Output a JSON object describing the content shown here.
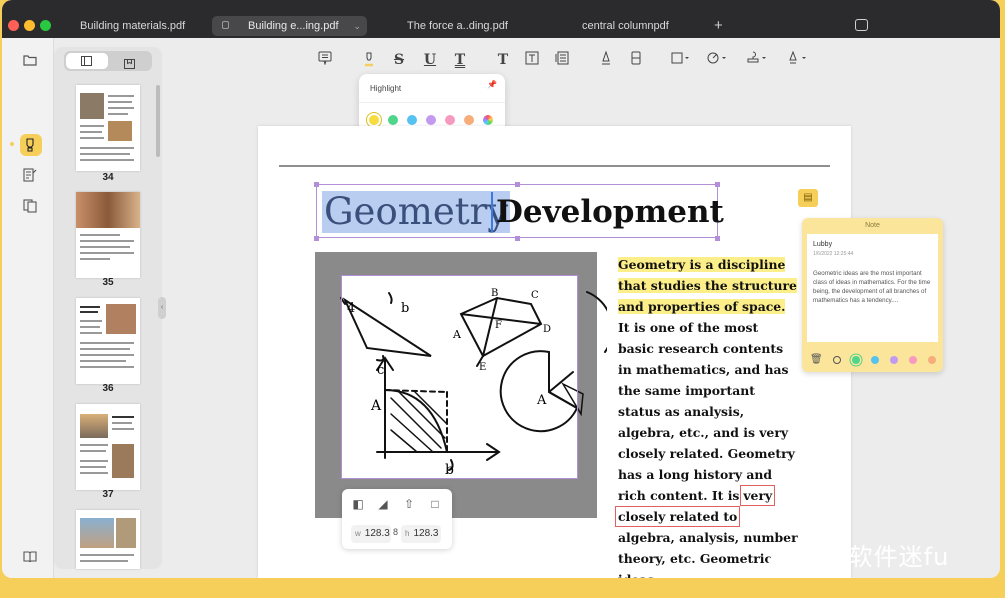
{
  "tabs": [
    {
      "label": "Building materials.pdf"
    },
    {
      "label": "Building e...ing.pdf"
    },
    {
      "label": "The force a..ding.pdf"
    },
    {
      "label": "central columnpdf"
    }
  ],
  "tab_add": "+",
  "thumbnails": [
    {
      "page": "34"
    },
    {
      "page": "35"
    },
    {
      "page": "36"
    },
    {
      "page": "37"
    }
  ],
  "popover": {
    "title": "Highlight",
    "colors": [
      "#f6dc3c",
      "#4fd68a",
      "#56c2f0",
      "#c39af0",
      "#f79ac0",
      "#f6ad7a",
      "rainbow"
    ]
  },
  "document": {
    "heading_selected": "Geometry",
    "heading_rest": "Development",
    "highlighted_text": "Geometry is a discipline that studies the structure and properties of space.",
    "body_text_1": " It is one of the most basic research contents in mathematics, and has the same important status as analysis, algebra, etc., and is very closely related. Geometry has a long history and rich content. It is",
    "boxed_text": "very closely related to",
    "body_text_2": " algebra, analysis, number theory, etc. Geometric ideas"
  },
  "crop_toolbar": {
    "width_label": "w",
    "width_value": "128.3",
    "height_label": "h",
    "height_value": "128.3",
    "link_glyph": "8"
  },
  "note": {
    "header": "Note",
    "author": "Lubby",
    "timestamp": "1/6/2022 12:25:44",
    "text": "Geometric ideas are the most important class of ideas in mathematics. For the time being, the development of all branches of mathematics has a tendency....",
    "colors": [
      "#4fd68a",
      "#56c2f0",
      "#c39af0",
      "#f79ac0",
      "#f6ad7a"
    ]
  },
  "watermark": "知乎 @软件迷fu",
  "accent_color": "#f6cf5a"
}
